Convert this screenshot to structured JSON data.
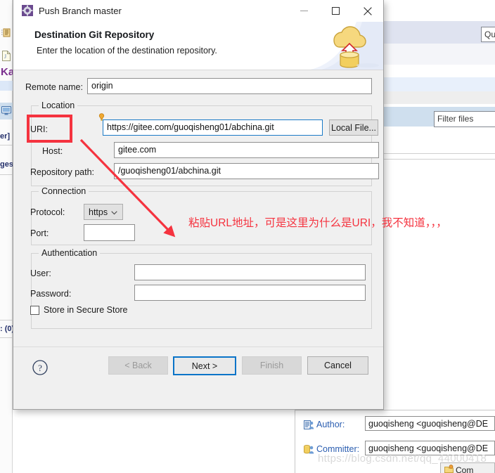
{
  "dialog": {
    "title": "Push Branch master",
    "title_icon": "gear-icon",
    "window_buttons": {
      "minimize": "—",
      "maximize": "□",
      "close": "✕"
    },
    "banner": {
      "heading": "Destination Git Repository",
      "subtitle": "Enter the location of the destination repository.",
      "art": "cloud-upload-database-icon"
    },
    "remote": {
      "label": "Remote name:",
      "value": "origin"
    },
    "location": {
      "group_title": "Location",
      "uri_label": "URI:",
      "uri_value": "https://gitee.com/guoqisheng01/abchina.git",
      "uri_hint_icon": "lightbulb-icon",
      "local_file_button": "Local File...",
      "host_label": "Host:",
      "host_value": "gitee.com",
      "repo_path_label": "Repository path:",
      "repo_path_value": "/guoqisheng01/abchina.git"
    },
    "connection": {
      "group_title": "Connection",
      "protocol_label": "Protocol:",
      "protocol_value": "https",
      "protocol_options": [
        "https"
      ],
      "port_label": "Port:",
      "port_value": ""
    },
    "authentication": {
      "group_title": "Authentication",
      "user_label": "User:",
      "user_value": "",
      "password_label": "Password:",
      "password_value": "",
      "store_secure_label": "Store in Secure Store",
      "store_secure_checked": false
    },
    "footer": {
      "help_icon": "question-mark-icon",
      "back": "< Back",
      "next": "Next >",
      "finish": "Finish",
      "cancel": "Cancel"
    }
  },
  "annotations": {
    "highlight_target": "URI:",
    "note_text": "粘贴URL地址，可是这里为什么是URI，我不知道，，，",
    "color": "#f5333f"
  },
  "background": {
    "left_rail": {
      "items": [
        {
          "name": "palette-icon",
          "label": ""
        },
        {
          "name": "file-icon",
          "label": ""
        },
        {
          "name": "project-label",
          "label": "Ka"
        },
        {
          "name": "console-icon",
          "label": ""
        },
        {
          "name": "editor-tab-label",
          "label": "er]"
        },
        {
          "name": "changes-tab-label",
          "label": "ges"
        },
        {
          "name": "count-label",
          "label": ": (0)"
        }
      ]
    },
    "quick_access": {
      "placeholder": "Qu"
    },
    "filter_files": {
      "placeholder": "Filter files"
    },
    "author": {
      "icon": "author-icon",
      "label": "Author:",
      "value": "guoqisheng <guoqisheng@DE"
    },
    "committer": {
      "icon": "committer-icon",
      "label": "Committer:",
      "value": "guoqisheng <guoqisheng@DE"
    },
    "commit_button": {
      "icon": "commit-icon",
      "label": "Com"
    },
    "watermark": "https://blog.csdn.net/qq_44000418"
  }
}
